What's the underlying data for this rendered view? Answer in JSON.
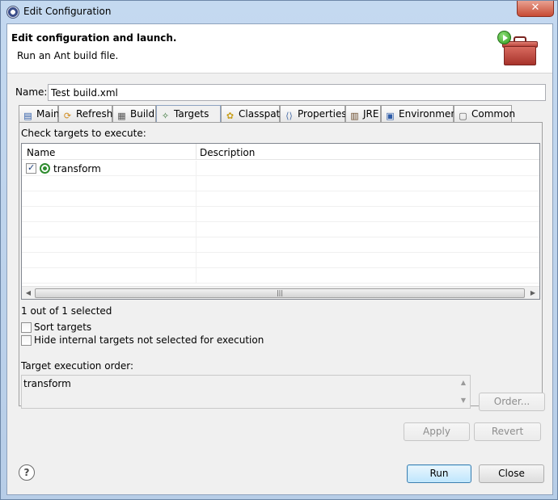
{
  "window": {
    "title": "Edit Configuration",
    "close_label": "✕"
  },
  "header": {
    "title": "Edit configuration and launch.",
    "description": "Run an Ant build file."
  },
  "name": {
    "label": "Name:",
    "value": "Test build.xml"
  },
  "tabs": [
    {
      "label": "Main",
      "icon": "main-tab-icon",
      "active": false
    },
    {
      "label": "Refresh",
      "icon": "refresh-icon",
      "active": false
    },
    {
      "label": "Build",
      "icon": "build-icon",
      "active": false
    },
    {
      "label": "Targets",
      "icon": "targets-icon",
      "active": true
    },
    {
      "label": "Classpath",
      "icon": "classpath-icon",
      "active": false
    },
    {
      "label": "Properties",
      "icon": "properties-icon",
      "active": false
    },
    {
      "label": "JRE",
      "icon": "jre-icon",
      "active": false
    },
    {
      "label": "Environment",
      "icon": "environment-icon",
      "active": false
    },
    {
      "label": "Common",
      "icon": "common-icon",
      "active": false
    }
  ],
  "targets_tab": {
    "check_title": "Check targets to execute:",
    "columns": [
      "Name",
      "Description"
    ],
    "rows": [
      {
        "name": "transform",
        "description": "",
        "checked": true
      }
    ],
    "selected_count": "1 out of 1 selected",
    "options": [
      {
        "label": "Sort targets",
        "checked": false
      },
      {
        "label": "Hide internal targets not selected for execution",
        "checked": false
      }
    ],
    "order_title": "Target execution order:",
    "order_value": "transform",
    "order_button": "Order..."
  },
  "buttons": {
    "apply": "Apply",
    "revert": "Revert",
    "run": "Run",
    "close": "Close",
    "help": "?"
  },
  "colors": {
    "accent": "#3c7fb1",
    "target_icon": "#2e8b2e",
    "toolbox": "#b43b32"
  }
}
